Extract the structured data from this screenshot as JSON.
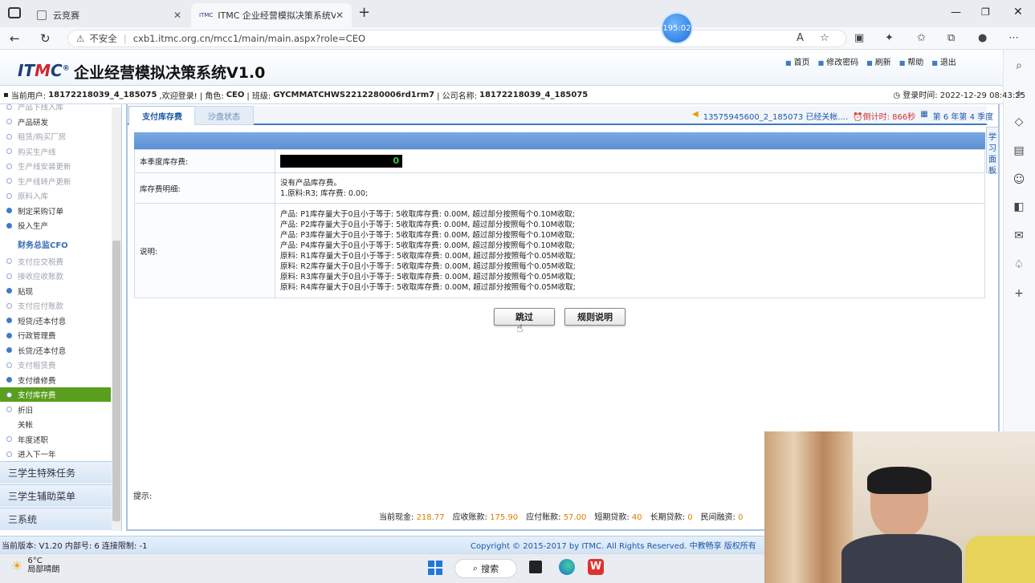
{
  "browser": {
    "tabs": [
      {
        "label": "云竞赛"
      },
      {
        "label": "ITMC 企业经营模拟决策系统V1.0"
      }
    ],
    "new_tab": "+",
    "security": "不安全",
    "url": "cxb1.itmc.org.cn/mcc1/main/main.aspx?role=CEO",
    "timer": "195:02"
  },
  "app": {
    "logo": "ITMC",
    "title": "企业经营模拟决策系统V1.0",
    "links": [
      "首页",
      "修改密码",
      "刷新",
      "帮助",
      "退出"
    ],
    "user": {
      "user_label": "当前用户:",
      "user_value": "18172218039_4_185075",
      "welcome": ",欢迎登录! | 角色:",
      "role": "CEO",
      "class_label": "| 班级:",
      "class_value": "GYCMMATCHWS2212280006rd1rm7",
      "company_label": "| 公司名称:",
      "company_value": "18172218039_4_185075"
    },
    "login_time": "登录时间: 2022-12-29 08:43:25"
  },
  "menu": {
    "items": [
      {
        "label": "产品下线入库",
        "state": "dim"
      },
      {
        "label": "产品研发",
        "state": "normal"
      },
      {
        "label": "租赁/购买厂房",
        "state": "dim"
      },
      {
        "label": "购买生产线",
        "state": "dim"
      },
      {
        "label": "生产线安装更新",
        "state": "dim"
      },
      {
        "label": "生产线转产更新",
        "state": "dim"
      },
      {
        "label": "原料入库",
        "state": "dim"
      },
      {
        "label": "制定采购订单",
        "state": "on"
      },
      {
        "label": "投入生产",
        "state": "on"
      }
    ],
    "cfo_head": "财务总监CFO",
    "cfo_items": [
      {
        "label": "支付应交税费",
        "state": "dim"
      },
      {
        "label": "接收应收账款",
        "state": "dim"
      },
      {
        "label": "贴现",
        "state": "on"
      },
      {
        "label": "支付应付账款",
        "state": "dim"
      },
      {
        "label": "短贷/还本付息",
        "state": "on"
      },
      {
        "label": "行政管理费",
        "state": "on"
      },
      {
        "label": "长贷/还本付息",
        "state": "on"
      },
      {
        "label": "支付租赁费",
        "state": "dim"
      },
      {
        "label": "支付维修费",
        "state": "on"
      },
      {
        "label": "支付库存费",
        "state": "sel"
      },
      {
        "label": "折旧",
        "state": "normal"
      },
      {
        "label": "关帐",
        "state": "plain"
      },
      {
        "label": "年度述职",
        "state": "normal"
      },
      {
        "label": "进入下一年",
        "state": "normal"
      }
    ],
    "sections": [
      "三学生特殊任务",
      "三学生辅助菜单",
      "三系统"
    ]
  },
  "main": {
    "tab_active": "支付库存费",
    "tab_other": "沙盘状态",
    "status_msg": "13575945600_2_185073 已经关帐....",
    "countdown": "倒计时: 866秒",
    "period": "第 6 年第 4 季度",
    "side_tab": "学习面板",
    "rows": {
      "fee_label": "本季度库存费:",
      "fee_value": "0",
      "detail_label": "库存费明细:",
      "detail_lines": [
        "没有产品库存费。",
        "1.原料:R3;  库存费: 0.00;"
      ],
      "note_label": "说明:",
      "note_lines": [
        "产品: P1库存量大于0且小于等于: 5收取库存费: 0.00M, 超过部分按照每个0.10M收取;",
        "产品: P2库存量大于0且小于等于: 5收取库存费: 0.00M, 超过部分按照每个0.10M收取;",
        "产品: P3库存量大于0且小于等于: 5收取库存费: 0.00M, 超过部分按照每个0.10M收取;",
        "产品: P4库存量大于0且小于等于: 5收取库存费: 0.00M, 超过部分按照每个0.10M收取;",
        "原料: R1库存量大于0且小于等于: 5收取库存费: 0.00M, 超过部分按照每个0.05M收取;",
        "原料: R2库存量大于0且小于等于: 5收取库存费: 0.00M, 超过部分按照每个0.05M收取;",
        "原料: R3库存量大于0且小于等于: 5收取库存费: 0.00M, 超过部分按照每个0.05M收取;",
        "原料: R4库存量大于0且小于等于: 5收取库存费: 0.00M, 超过部分按照每个0.05M收取;"
      ]
    },
    "btn_skip": "跳过",
    "btn_rules": "规则说明",
    "hint": "提示:",
    "finance": {
      "cash_label": "当前现金:",
      "cash": "218.77",
      "ar_label": "应收账款:",
      "ar": "175.90",
      "ap_label": "应付账款:",
      "ap": "57.00",
      "short_label": "短期贷款:",
      "short": "40",
      "long_label": "长期贷款:",
      "long": "0",
      "private_label": "民间融资:",
      "private": "0"
    }
  },
  "footer": {
    "version": "当前版本: V1.20 内部号: 6 连接限制: -1",
    "copyright": "Copyright © 2015-2017 by ITMC. All Rights Reserved. 中教畅享 版权所有"
  },
  "taskbar": {
    "temp": "6°C",
    "weather": "局部晴朗",
    "search": "搜索"
  }
}
